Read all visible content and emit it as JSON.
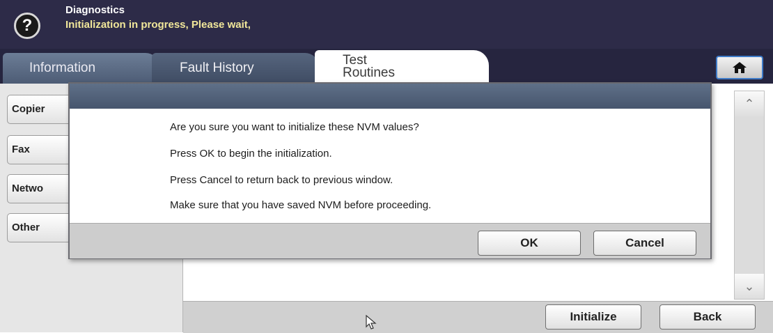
{
  "header": {
    "help_icon": "question-mark-icon",
    "title": "Diagnostics",
    "status": "Initialization in progress, Please wait,"
  },
  "tabs": [
    {
      "label": "Information"
    },
    {
      "label": "Fault History"
    },
    {
      "label_line1": "Test",
      "label_line2": "Routines",
      "selected": true
    }
  ],
  "home_icon": "home-icon",
  "sidebar": {
    "items": [
      {
        "label": "Copier"
      },
      {
        "label": "Fax"
      },
      {
        "label": "Netwo"
      },
      {
        "label": "Other"
      }
    ]
  },
  "scrollbar": {
    "up_icon": "chevron-up-icon",
    "down_icon": "chevron-down-icon"
  },
  "bottom": {
    "initialize_label": "Initialize",
    "back_label": "Back"
  },
  "dialog": {
    "lines": [
      "Are you sure you want to initialize these NVM values?",
      "Press OK to begin the initialization.",
      "Press Cancel to return back to previous window.",
      "Make sure that you have saved NVM before proceeding."
    ],
    "ok_label": "OK",
    "cancel_label": "Cancel"
  },
  "colors": {
    "header_bg": "#2d2b48",
    "status_text": "#f1e79a",
    "tab_bg": "#56657e",
    "panel_bg": "#e6e6e6"
  }
}
